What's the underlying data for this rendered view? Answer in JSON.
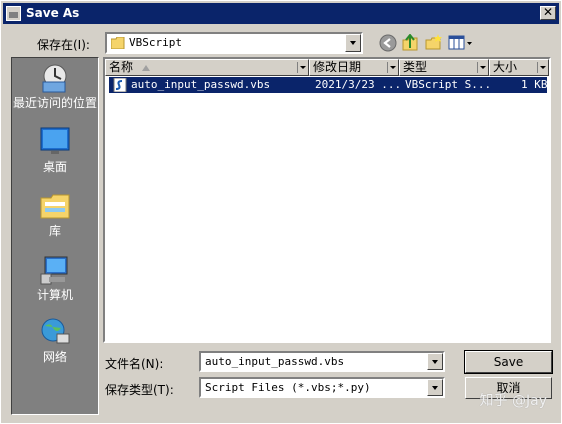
{
  "window": {
    "title": "Save As",
    "close_glyph": "✕"
  },
  "location": {
    "label": "保存在(I):",
    "value": "VBScript"
  },
  "toolbar": {
    "icons": [
      "back-icon",
      "up-folder-icon",
      "new-folder-icon",
      "view-menu-icon"
    ]
  },
  "places": [
    {
      "id": "recent",
      "label": "最近访问的位置",
      "icon": "recent-places-icon"
    },
    {
      "id": "desktop",
      "label": "桌面",
      "icon": "desktop-icon"
    },
    {
      "id": "libraries",
      "label": "库",
      "icon": "libraries-icon"
    },
    {
      "id": "computer",
      "label": "计算机",
      "icon": "computer-icon"
    },
    {
      "id": "network",
      "label": "网络",
      "icon": "network-icon"
    }
  ],
  "columns": [
    "名称",
    "修改日期",
    "类型",
    "大小"
  ],
  "files": [
    {
      "name": "auto_input_passwd.vbs",
      "modified": "2021/3/23 ...",
      "type": "VBScript S...",
      "size": "1 KB",
      "selected": true
    }
  ],
  "filename": {
    "label": "文件名(N):",
    "value": "auto_input_passwd.vbs"
  },
  "filetype": {
    "label": "保存类型(T):",
    "value": "Script Files (*.vbs;*.py)"
  },
  "buttons": {
    "save": "Save",
    "cancel": "取消"
  },
  "watermark": "知乎 @Jay",
  "colors": {
    "title_bar": "#0a246a",
    "selection": "#0a246a",
    "face": "#d4d0c8",
    "sidebar": "#808080"
  }
}
